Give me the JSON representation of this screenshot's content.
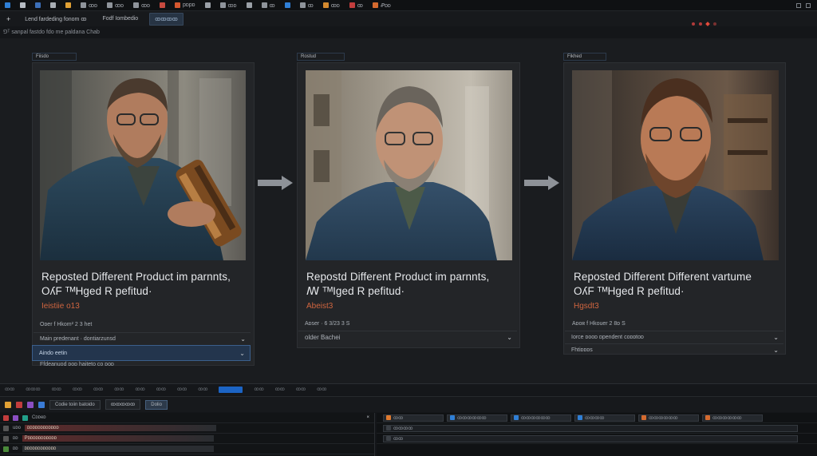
{
  "menubar": {
    "items": [
      {
        "label": "",
        "color": "#2f7fd6"
      },
      {
        "label": "",
        "color": "#b7bcc3"
      },
      {
        "label": "",
        "color": "#3c6fb8"
      },
      {
        "label": "",
        "color": "#a8adb3"
      },
      {
        "label": "",
        "color": "#e0a034"
      },
      {
        "label": "ꝏᴅ",
        "color": "#8f949b"
      },
      {
        "label": "ꝏᴅ",
        "color": "#8f949b"
      },
      {
        "label": "ꝏᴅ",
        "color": "#8f949b"
      },
      {
        "label": "",
        "color": "#c84a3f"
      },
      {
        "label": "pᴅpᴅ",
        "color": "#d5572f"
      },
      {
        "label": "",
        "color": "#9aa0a7"
      },
      {
        "label": "ꝏᴅ",
        "color": "#8f949b"
      },
      {
        "label": "",
        "color": "#9aa0a7"
      },
      {
        "label": "ꝏ",
        "color": "#8f949b"
      },
      {
        "label": "",
        "color": "#2f7fd6"
      },
      {
        "label": "ꝏ",
        "color": "#8f949b"
      },
      {
        "label": "ꝏᴅ",
        "color": "#d48a2f"
      },
      {
        "label": "ꝏ",
        "color": "#c23d3d"
      },
      {
        "label": "Ꝓᴅᴅ",
        "color": "#d46a2f"
      }
    ]
  },
  "toolbar": {
    "tabs": [
      "Lend fardeding fonom  ꝏ",
      "Fodf Iombedio",
      "ꝏꝏꝏꝏ"
    ],
    "plus_label": "+"
  },
  "status_line": "⅁ᵀ sanpal fastdo fdo me paldana Chab",
  "cards": [
    {
      "tag": "Fiisdo",
      "title_line1": "Reposted Different Product im parnnts,",
      "title_line2": "OʎF ᵀᴹHged R pefitud·",
      "accent": "Ieistiie o13",
      "meta": "Oᴅer f Hkom² 2 3 het",
      "rows": [
        "Main predenant · dontiarzunsd",
        "Aindo  eetin",
        "Ffdeanuod ᴅoᴅ haiteto ᴄo ᴅoᴅ"
      ],
      "selected_row": 1
    },
    {
      "tag": "Rostud",
      "title_line1": "Repostd Different Product im parnnts,",
      "title_line2": "ꟿ ᵀᴹIged R pefitud·",
      "accent": "Abeist3",
      "meta": "Aᴅser · 6  3/23  3 S",
      "rows": [
        "older  Bachei"
      ],
      "selected_row": -1
    },
    {
      "tag": "Fikhed",
      "title_line1": "Reposted Different Different vartume",
      "title_line2": "OʎF ᵀᴹHged R pefitud·",
      "accent": "Hgsdt3",
      "meta": "Aᴅoʀ f  Hkouer 2 8ᴅ S",
      "rows": [
        "Iorce ᴅooᴅ ᴅpendent ᴄoᴅᴅtoᴅ",
        "Fhtiᴅᴅᴅs"
      ],
      "selected_row": -1
    }
  ],
  "timeline": {
    "scrub_labels": [
      "ꝏꝏ",
      "ꝏꝏꝏ",
      "ꝏꝏ",
      "ꝏꝏ",
      "ꝏꝏ",
      "ꝏꝏ",
      "ꝏꝏ",
      "ꝏꝏ",
      "ꝏꝏ",
      "ꝏꝏ",
      "ꝏꝏ",
      "ꝏꝏ",
      "ꝏꝏ",
      "ꝏꝏ"
    ],
    "tool_buttons": [
      "Codie  toiin batoido",
      "ꝏꝏꝏꝏꝏ",
      "Dolio"
    ],
    "left_tracks": [
      {
        "label": "Cᴅᴅeᴅ",
        "name": ""
      },
      {
        "label": "uᴅo",
        "name": "ᴅᴅᴅᴅᴅᴅᴅᴅᴅᴅᴅᴅ"
      },
      {
        "label": "ᴅᴅ",
        "name": "Pᴅᴅᴅᴅᴅᴅᴅᴅᴅᴅᴅ"
      },
      {
        "label": "ᴅᴅ",
        "name": "ᴅᴅᴅᴅᴅᴅᴅᴅᴅᴅᴅᴅ"
      }
    ],
    "right_rows": [
      [
        "ꝏꝏ",
        "ꝏꝏꝏꝏꝏꝏ",
        "ꝏꝏꝏꝏꝏꝏ",
        "ꝏꝏꝏꝏ",
        "ꝏꝏꝏꝏꝏꝏ",
        "ꝏꝏꝏꝏꝏꝏ"
      ],
      [
        "ꝏꝏꝏꝏ"
      ],
      [
        "ꝏꝏ"
      ]
    ]
  }
}
